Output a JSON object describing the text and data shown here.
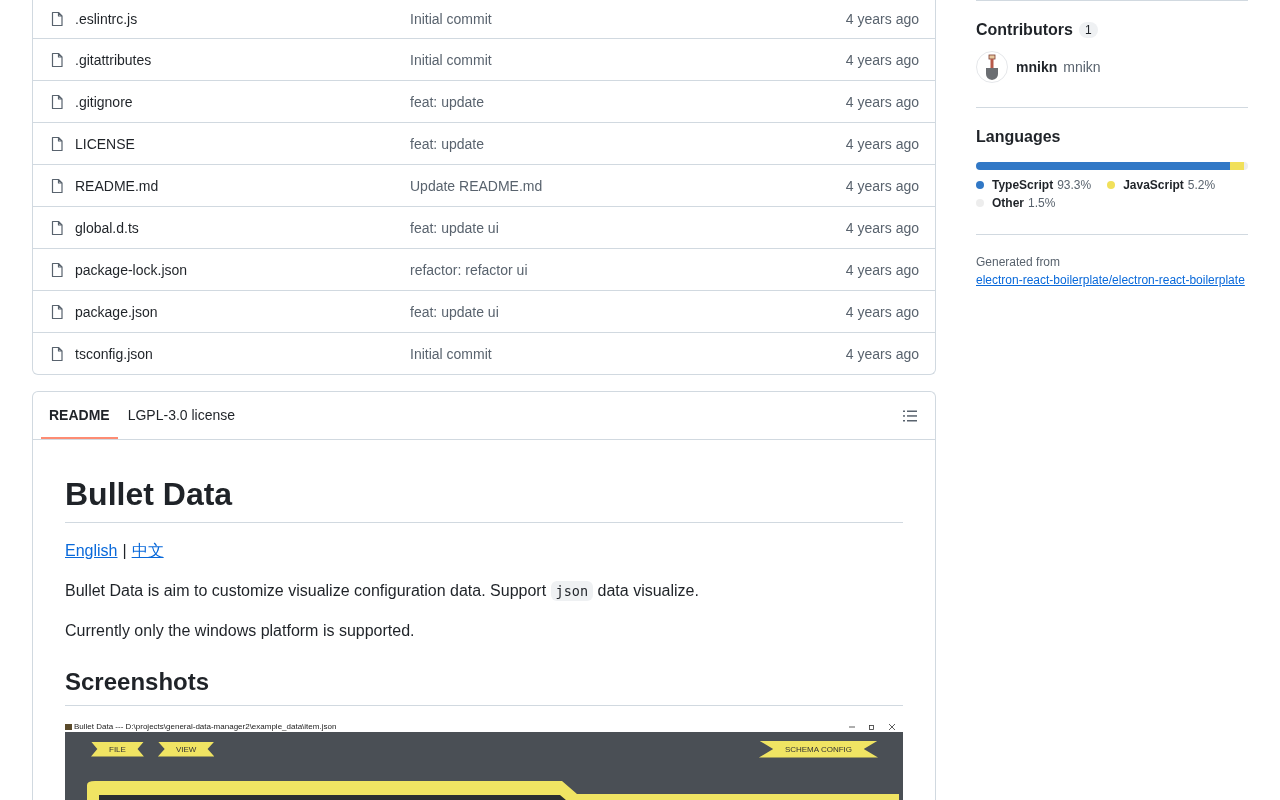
{
  "files": [
    {
      "name": ".eslintrc.js",
      "message": "Initial commit",
      "time": "4 years ago"
    },
    {
      "name": ".gitattributes",
      "message": "Initial commit",
      "time": "4 years ago"
    },
    {
      "name": ".gitignore",
      "message": "feat: update",
      "time": "4 years ago"
    },
    {
      "name": "LICENSE",
      "message": "feat: update",
      "time": "4 years ago"
    },
    {
      "name": "README.md",
      "message": "Update README.md",
      "time": "4 years ago"
    },
    {
      "name": "global.d.ts",
      "message": "feat: update ui",
      "time": "4 years ago"
    },
    {
      "name": "package-lock.json",
      "message": "refactor: refactor ui",
      "time": "4 years ago"
    },
    {
      "name": "package.json",
      "message": "feat: update ui",
      "time": "4 years ago"
    },
    {
      "name": "tsconfig.json",
      "message": "Initial commit",
      "time": "4 years ago"
    }
  ],
  "readme": {
    "tabs": [
      {
        "label": "README",
        "selected": true
      },
      {
        "label": "LGPL-3.0 license",
        "selected": false
      }
    ],
    "title": "Bullet Data",
    "links": [
      "English",
      "中文"
    ],
    "link_separator": "|",
    "intro": {
      "before": "Bullet Data is aim to customize visualize configuration data. Support ",
      "code": "json",
      "after": " data visualize."
    },
    "note": "Currently only the windows platform is supported.",
    "section": "Screenshots",
    "screenshot": {
      "window_title": "Bullet Data --- D:\\projects\\general-data-manager2\\example_data\\item.json",
      "menu": [
        "FILE",
        "VIEW"
      ],
      "config_button": "SCHEMA CONFIG"
    }
  },
  "contributors": {
    "title": "Contributors",
    "count": "1",
    "people": [
      {
        "login": "mnikn",
        "name": "mnikn"
      }
    ]
  },
  "languages": {
    "title": "Languages",
    "items": [
      {
        "name": "TypeScript",
        "percent": "93.3%",
        "level": 0.933,
        "color": "#3178c6"
      },
      {
        "name": "JavaScript",
        "percent": "5.2%",
        "level": 0.052,
        "color": "#f1e05a"
      },
      {
        "name": "Other",
        "percent": "1.5%",
        "level": 0.015,
        "color": "#ededed"
      }
    ]
  },
  "generated": {
    "prefix": "Generated from ",
    "link": "electron-react-boilerplate/electron-react-boilerplate"
  }
}
